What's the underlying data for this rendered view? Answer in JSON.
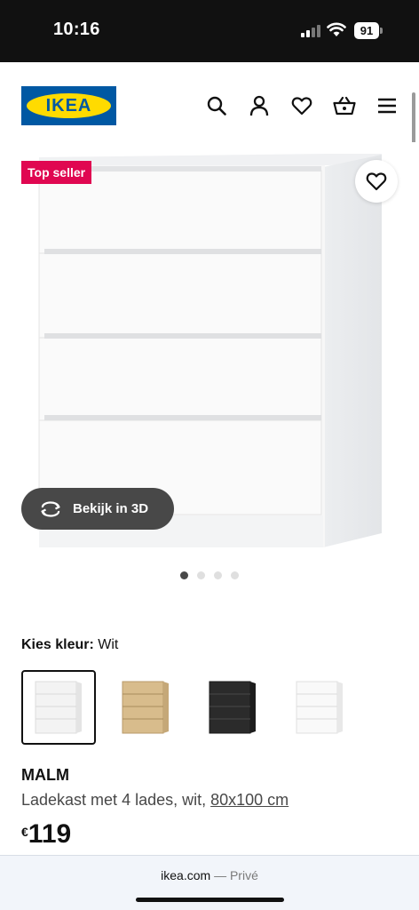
{
  "status": {
    "time": "10:16",
    "battery": "91"
  },
  "header": {
    "logo_text": "IKEA",
    "icons": [
      "search-icon",
      "user-icon",
      "heart-icon",
      "basket-icon",
      "menu-icon"
    ]
  },
  "product_image": {
    "badge": "Top seller",
    "view_3d_label": "Bekijk in 3D",
    "carousel_count": 4,
    "carousel_active": 1
  },
  "color": {
    "label": "Kies kleur:",
    "value": "Wit",
    "options": [
      {
        "name": "Wit",
        "hex": "#f4f4f4",
        "selected": true
      },
      {
        "name": "eikenfineer",
        "hex": "#d8bc8c",
        "selected": false
      },
      {
        "name": "zwartbruin",
        "hex": "#2b2b2b",
        "selected": false
      },
      {
        "name": "hoogglans wit",
        "hex": "#f8f8f8",
        "selected": false
      }
    ]
  },
  "product": {
    "name": "MALM",
    "description": "Ladekast met 4 lades, wit,",
    "dimensions": "80x100 cm",
    "currency": "€",
    "price": "119"
  },
  "browser": {
    "domain": "ikea.com",
    "separator": "—",
    "mode": "Privé"
  },
  "colors": {
    "badge": "#e00751",
    "brand_blue": "#0058a3",
    "brand_yellow": "#ffdb00"
  }
}
